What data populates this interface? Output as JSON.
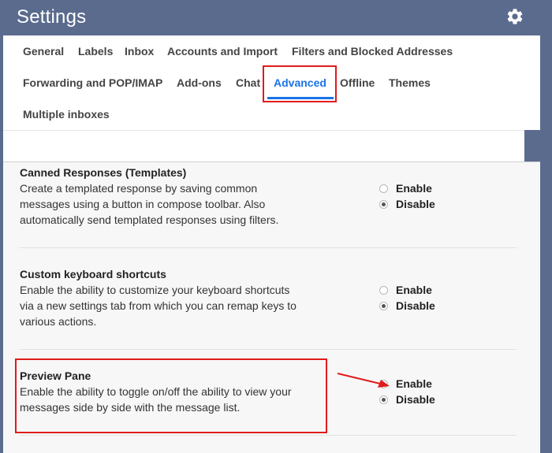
{
  "header": {
    "title": "Settings",
    "settings_icon": "gear-icon"
  },
  "tabs": [
    {
      "label": "General",
      "active": false
    },
    {
      "label": "Labels",
      "active": false
    },
    {
      "label": "Inbox",
      "active": false
    },
    {
      "label": "Accounts and Import",
      "active": false
    },
    {
      "label": "Filters and Blocked Addresses",
      "active": false
    },
    {
      "label": "Forwarding and POP/IMAP",
      "active": false
    },
    {
      "label": "Add-ons",
      "active": false
    },
    {
      "label": "Chat",
      "active": false
    },
    {
      "label": "Advanced",
      "active": true
    },
    {
      "label": "Offline",
      "active": false
    },
    {
      "label": "Themes",
      "active": false
    },
    {
      "label": "Multiple inboxes",
      "active": false
    }
  ],
  "sections": [
    {
      "title": "Canned Responses (Templates)",
      "description": "Create a templated response by saving common messages using a button in compose toolbar. Also automatically send templated responses using filters.",
      "options": [
        {
          "label": "Enable",
          "checked": false
        },
        {
          "label": "Disable",
          "checked": true
        }
      ]
    },
    {
      "title": "Custom keyboard shortcuts",
      "description": "Enable the ability to customize your keyboard shortcuts via a new settings tab from which you can remap keys to various actions.",
      "options": [
        {
          "label": "Enable",
          "checked": false
        },
        {
          "label": "Disable",
          "checked": true
        }
      ]
    },
    {
      "title": "Preview Pane",
      "description": "Enable the ability to toggle on/off the ability to view your messages side by side with the message list.",
      "options": [
        {
          "label": "Enable",
          "checked": false
        },
        {
          "label": "Disable",
          "checked": true
        }
      ]
    }
  ],
  "colors": {
    "header_bg": "#5a6b8e",
    "accent": "#1a73e8",
    "highlight": "#e01b1b"
  }
}
